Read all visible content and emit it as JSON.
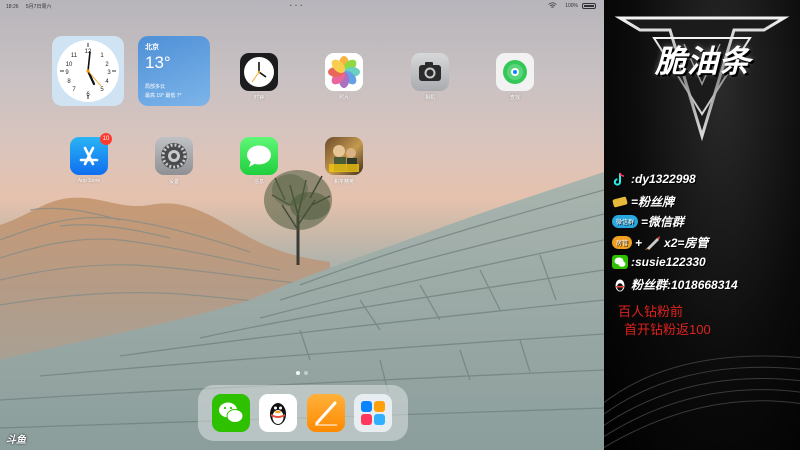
{
  "statusbar": {
    "time": "18:26",
    "date": "5月7日周六",
    "dots": "• • •",
    "battery": "100%"
  },
  "widgets": {
    "weather": {
      "city": "北京",
      "temp": "13°",
      "condition": "局部多云",
      "range": "最高 19° 最低 7°"
    }
  },
  "apps": [
    {
      "name": "时钟"
    },
    {
      "name": "照片"
    },
    {
      "name": "相机"
    },
    {
      "name": "查找"
    },
    {
      "name": "App Store",
      "badge": "10"
    },
    {
      "name": "设置"
    },
    {
      "name": "信息"
    },
    {
      "name": "和平精英"
    }
  ],
  "dock_apps": [
    "微信",
    "QQ",
    "Pages",
    "应用库"
  ],
  "watermark": "斗鱼",
  "panel": {
    "logo": "脆油条",
    "tiktok": ":dy1322998",
    "fans_badge": "=粉丝牌",
    "wechat_group_tag": "微信群",
    "wechat_group": "=微信群",
    "room_tag": "房管",
    "room_text": "x2=房管",
    "wechat": ":susie122330",
    "fans_group": "粉丝群:1018668314",
    "promo1": "百人钻粉前",
    "promo2_text": "首开钻粉返",
    "promo2_num": "100"
  },
  "colors": {
    "promo": "#e0221e",
    "badge": "#ff3b30",
    "weather_bg": "#4e8fd6"
  }
}
